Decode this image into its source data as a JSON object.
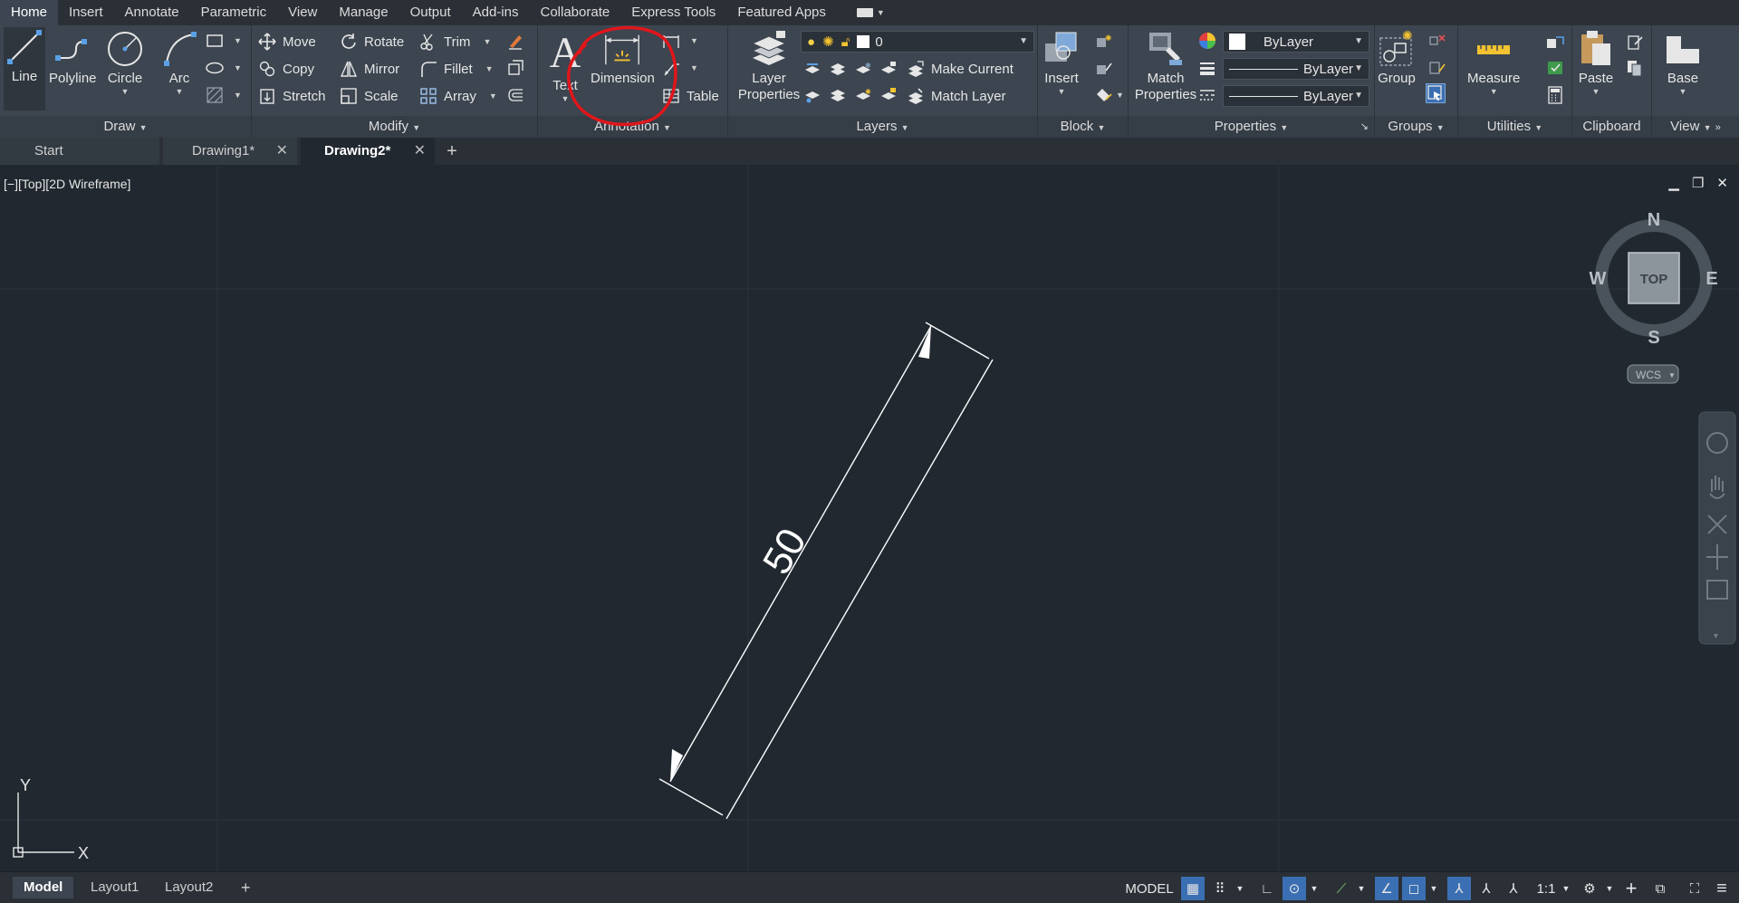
{
  "menu": {
    "tabs": [
      "Home",
      "Insert",
      "Annotate",
      "Parametric",
      "View",
      "Manage",
      "Output",
      "Add-ins",
      "Collaborate",
      "Express Tools",
      "Featured Apps"
    ]
  },
  "ribbon": {
    "draw": {
      "title": "Draw",
      "line": "Line",
      "polyline": "Polyline",
      "circle": "Circle",
      "arc": "Arc"
    },
    "modify": {
      "title": "Modify",
      "move": "Move",
      "rotate": "Rotate",
      "trim": "Trim",
      "copy": "Copy",
      "mirror": "Mirror",
      "fillet": "Fillet",
      "stretch": "Stretch",
      "scale": "Scale",
      "array": "Array"
    },
    "annotation": {
      "title": "Annotation",
      "text": "Text",
      "dimension": "Dimension",
      "table": "Table"
    },
    "layers": {
      "title": "Layers",
      "layer_properties": "Layer Properties",
      "current_layer": "0",
      "make_current": "Make Current",
      "match_layer": "Match Layer"
    },
    "block": {
      "title": "Block",
      "insert": "Insert"
    },
    "properties": {
      "title": "Properties",
      "match_properties": "Match Properties",
      "color": "ByLayer",
      "linetype": "ByLayer",
      "lineweight": "ByLayer"
    },
    "groups": {
      "title": "Groups",
      "group": "Group"
    },
    "utilities": {
      "title": "Utilities",
      "measure": "Measure"
    },
    "clipboard": {
      "title": "Clipboard",
      "paste": "Paste"
    },
    "view": {
      "title": "View",
      "base": "Base"
    }
  },
  "doc_tabs": [
    {
      "label": "Start"
    },
    {
      "label": "Drawing1*"
    },
    {
      "label": "Drawing2*"
    }
  ],
  "viewport": {
    "label": "[−][Top][2D Wireframe]",
    "dimension_text": "50",
    "viewcube": {
      "n": "N",
      "s": "S",
      "e": "E",
      "w": "W",
      "top": "TOP",
      "wcs": "WCS"
    },
    "ucs": {
      "x": "X",
      "y": "Y"
    }
  },
  "layout_tabs": [
    "Model",
    "Layout1",
    "Layout2"
  ],
  "status": {
    "model": "MODEL",
    "scale": "1:1"
  },
  "colors": {
    "accent": "#3b6fb3",
    "highlight_circle": "#e0161b",
    "canvas": "#212830"
  }
}
